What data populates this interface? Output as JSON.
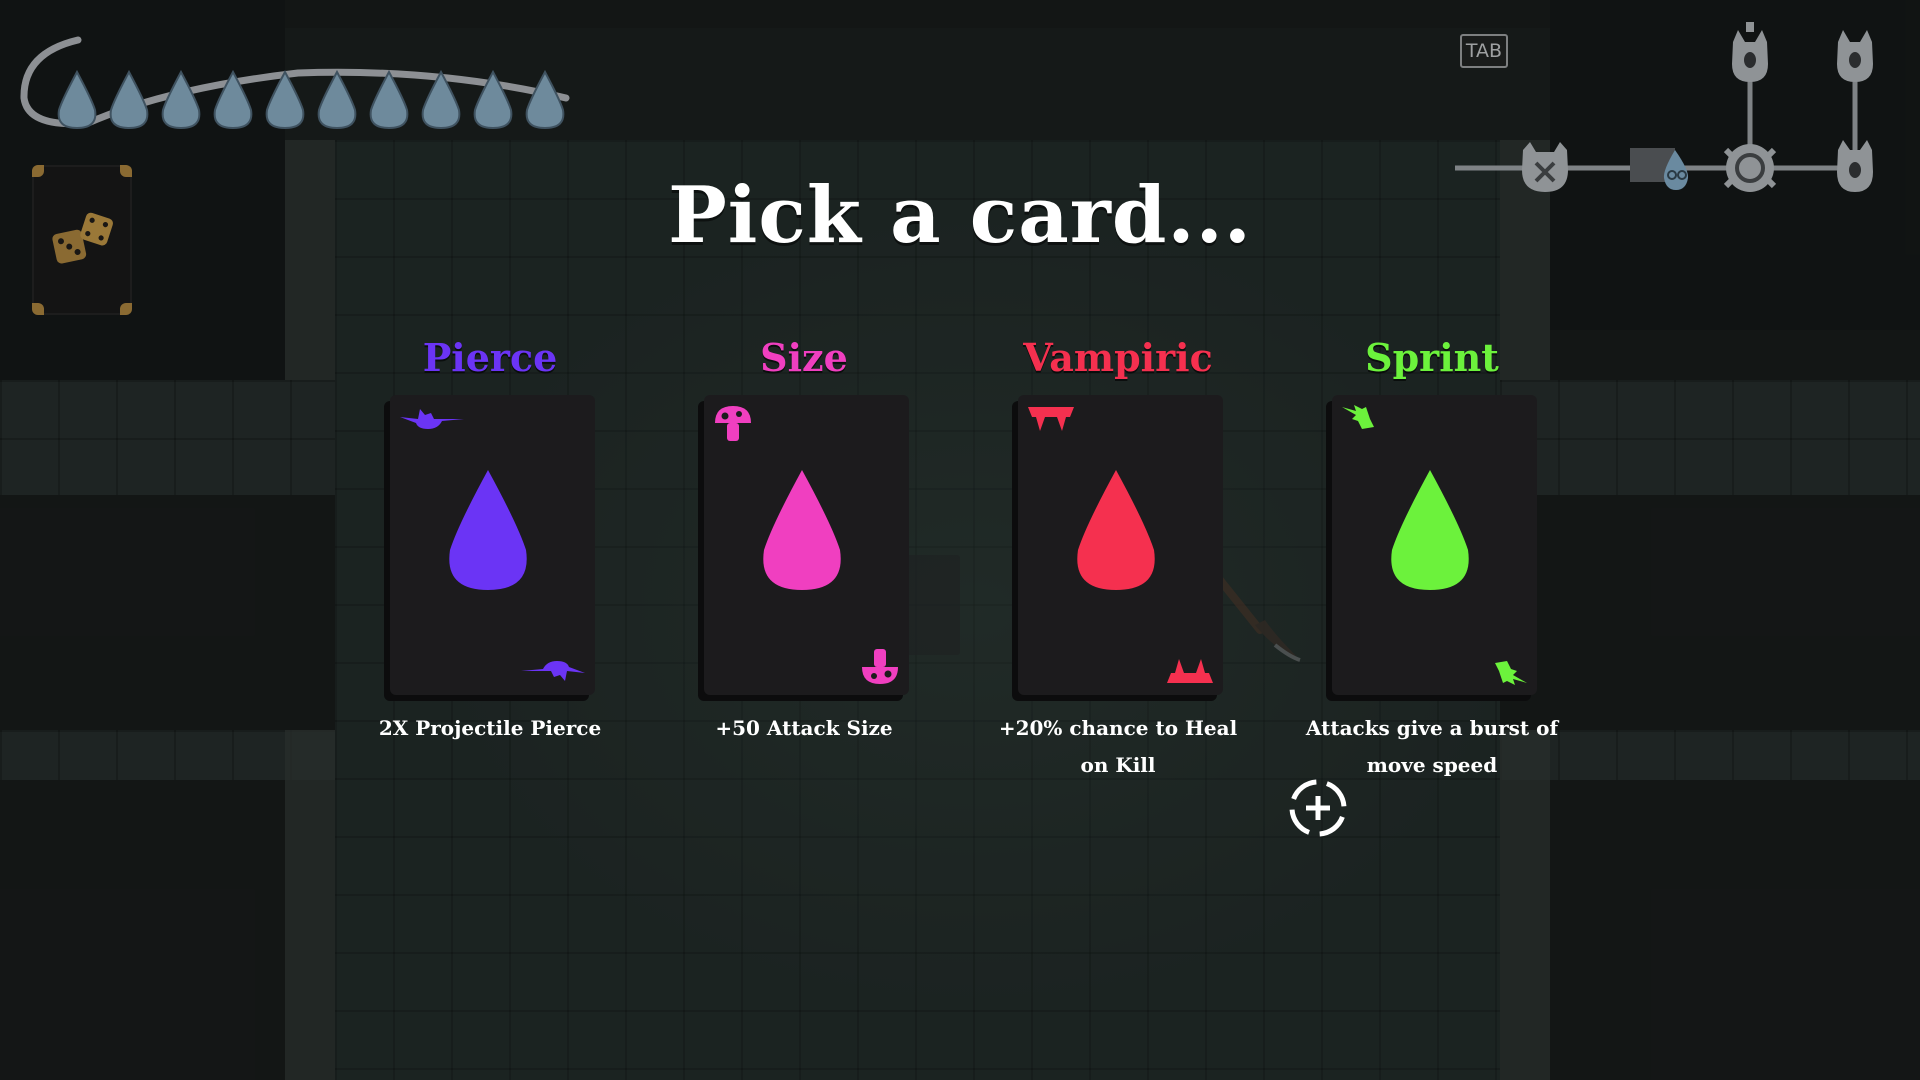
{
  "hud": {
    "drops_count": 10,
    "drop_color": "#6e8a9c",
    "tab_label": "TAB"
  },
  "title": "Pick a card...",
  "cards": [
    {
      "name": "Pierce",
      "description": "2X Projectile Pierce",
      "color": "#6b34f5",
      "symbol": "bat-icon"
    },
    {
      "name": "Size",
      "description": "+50 Attack Size",
      "color": "#f03fc0",
      "symbol": "mushroom-icon"
    },
    {
      "name": "Vampiric",
      "description": "+20% chance to Heal on Kill",
      "color": "#f5304f",
      "symbol": "fangs-icon"
    },
    {
      "name": "Sprint",
      "description": "Attacks give a burst of move speed",
      "color": "#6cf23c",
      "symbol": "winged-boot-icon"
    }
  ],
  "minimap": {
    "rooms": [
      "skull-room-icon",
      "shop-room-icon",
      "current-room-icon",
      "boss-room-icon",
      "unexplored-room-icon",
      "unexplored-room-icon"
    ]
  }
}
